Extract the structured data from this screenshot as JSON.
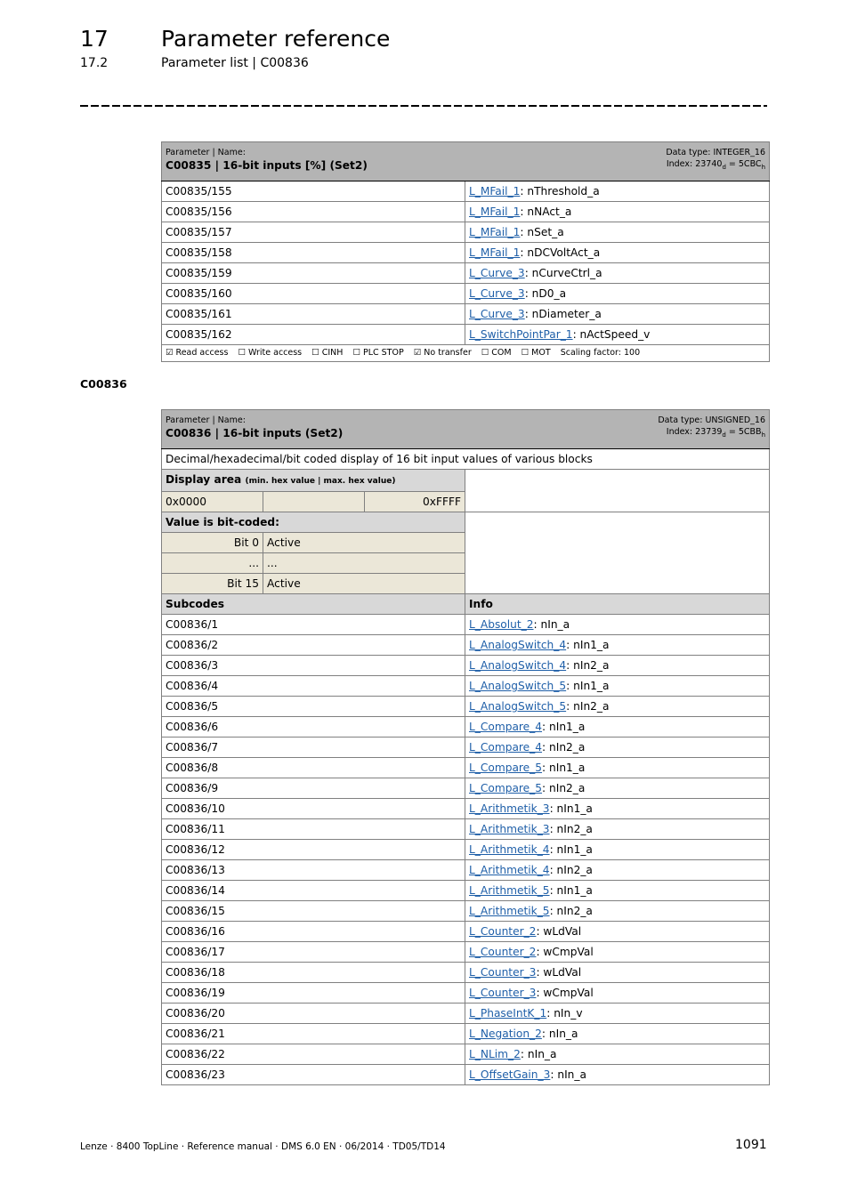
{
  "header": {
    "chapter_number": "17",
    "chapter_title": "Parameter reference",
    "section_number": "17.2",
    "section_title": "Parameter list | C00836"
  },
  "table_c00835": {
    "label": "Parameter | Name:",
    "name": "C00835 | 16-bit inputs [%] (Set2)",
    "data_type": "Data type: INTEGER_16",
    "index_prefix": "Index: 23740",
    "index_dec_sub": "d",
    "index_mid": " = 5CBC",
    "index_hex_sub": "h",
    "rows": [
      {
        "code": "C00835/155",
        "link": "L_MFail_1",
        "signal": ": nThreshold_a"
      },
      {
        "code": "C00835/156",
        "link": "L_MFail_1",
        "signal": ": nNAct_a"
      },
      {
        "code": "C00835/157",
        "link": "L_MFail_1",
        "signal": ": nSet_a"
      },
      {
        "code": "C00835/158",
        "link": "L_MFail_1",
        "signal": ": nDCVoltAct_a"
      },
      {
        "code": "C00835/159",
        "link": "L_Curve_3",
        "signal": ": nCurveCtrl_a"
      },
      {
        "code": "C00835/160",
        "link": "L_Curve_3",
        "signal": ": nD0_a"
      },
      {
        "code": "C00835/161",
        "link": "L_Curve_3",
        "signal": ": nDiameter_a"
      },
      {
        "code": "C00835/162",
        "link": "L_SwitchPointPar_1",
        "signal": ": nActSpeed_v"
      }
    ],
    "flags": {
      "read_access": "☑ Read access",
      "write_access": "☐ Write access",
      "cinh": "☐ CINH",
      "plc_stop": "☐ PLC STOP",
      "no_transfer": "☑ No transfer",
      "com": "☐ COM",
      "mot": "☐ MOT",
      "scaling": "Scaling factor: 100"
    }
  },
  "subheading": "C00836",
  "table_c00836": {
    "label": "Parameter | Name:",
    "name": "C00836 | 16-bit inputs (Set2)",
    "data_type": "Data type: UNSIGNED_16",
    "index_prefix": "Index: 23739",
    "index_dec_sub": "d",
    "index_mid": " = 5CBB",
    "index_hex_sub": "h",
    "description": "Decimal/hexadecimal/bit coded display of 16 bit input values of various blocks",
    "display_area_label": "Display area",
    "display_area_note": "(min. hex value | max. hex value)",
    "min_value": "0x0000",
    "max_value": "0xFFFF",
    "bitcoded_label": "Value is bit-coded:",
    "bits": [
      {
        "bit": "Bit 0",
        "meaning": "Active"
      },
      {
        "bit": "...",
        "meaning": "..."
      },
      {
        "bit": "Bit 15",
        "meaning": "Active"
      }
    ],
    "col_subcodes": "Subcodes",
    "col_info": "Info",
    "rows": [
      {
        "code": "C00836/1",
        "link": "L_Absolut_2",
        "signal": ": nIn_a"
      },
      {
        "code": "C00836/2",
        "link": "L_AnalogSwitch_4",
        "signal": ": nIn1_a"
      },
      {
        "code": "C00836/3",
        "link": "L_AnalogSwitch_4",
        "signal": ": nIn2_a"
      },
      {
        "code": "C00836/4",
        "link": "L_AnalogSwitch_5",
        "signal": ": nIn1_a"
      },
      {
        "code": "C00836/5",
        "link": "L_AnalogSwitch_5",
        "signal": ": nIn2_a"
      },
      {
        "code": "C00836/6",
        "link": "L_Compare_4",
        "signal": ": nIn1_a"
      },
      {
        "code": "C00836/7",
        "link": "L_Compare_4",
        "signal": ": nIn2_a"
      },
      {
        "code": "C00836/8",
        "link": "L_Compare_5",
        "signal": ": nIn1_a"
      },
      {
        "code": "C00836/9",
        "link": "L_Compare_5",
        "signal": ": nIn2_a"
      },
      {
        "code": "C00836/10",
        "link": "L_Arithmetik_3",
        "signal": ": nIn1_a"
      },
      {
        "code": "C00836/11",
        "link": "L_Arithmetik_3",
        "signal": ": nIn2_a"
      },
      {
        "code": "C00836/12",
        "link": "L_Arithmetik_4",
        "signal": ": nIn1_a"
      },
      {
        "code": "C00836/13",
        "link": "L_Arithmetik_4",
        "signal": ": nIn2_a"
      },
      {
        "code": "C00836/14",
        "link": "L_Arithmetik_5",
        "signal": ": nIn1_a"
      },
      {
        "code": "C00836/15",
        "link": "L_Arithmetik_5",
        "signal": ": nIn2_a"
      },
      {
        "code": "C00836/16",
        "link": "L_Counter_2",
        "signal": ": wLdVal"
      },
      {
        "code": "C00836/17",
        "link": "L_Counter_2",
        "signal": ": wCmpVal"
      },
      {
        "code": "C00836/18",
        "link": "L_Counter_3",
        "signal": ": wLdVal"
      },
      {
        "code": "C00836/19",
        "link": "L_Counter_3",
        "signal": ": wCmpVal"
      },
      {
        "code": "C00836/20",
        "link": "L_PhaseIntK_1",
        "signal": ": nIn_v"
      },
      {
        "code": "C00836/21",
        "link": "L_Negation_2",
        "signal": ": nIn_a"
      },
      {
        "code": "C00836/22",
        "link": "L_NLim_2",
        "signal": ": nIn_a"
      },
      {
        "code": "C00836/23",
        "link": "L_OffsetGain_3",
        "signal": ": nIn_a"
      }
    ]
  },
  "footer": {
    "text": "Lenze · 8400 TopLine · Reference manual · DMS 6.0 EN · 06/2014 · TD05/TD14",
    "page_number": "1091"
  }
}
